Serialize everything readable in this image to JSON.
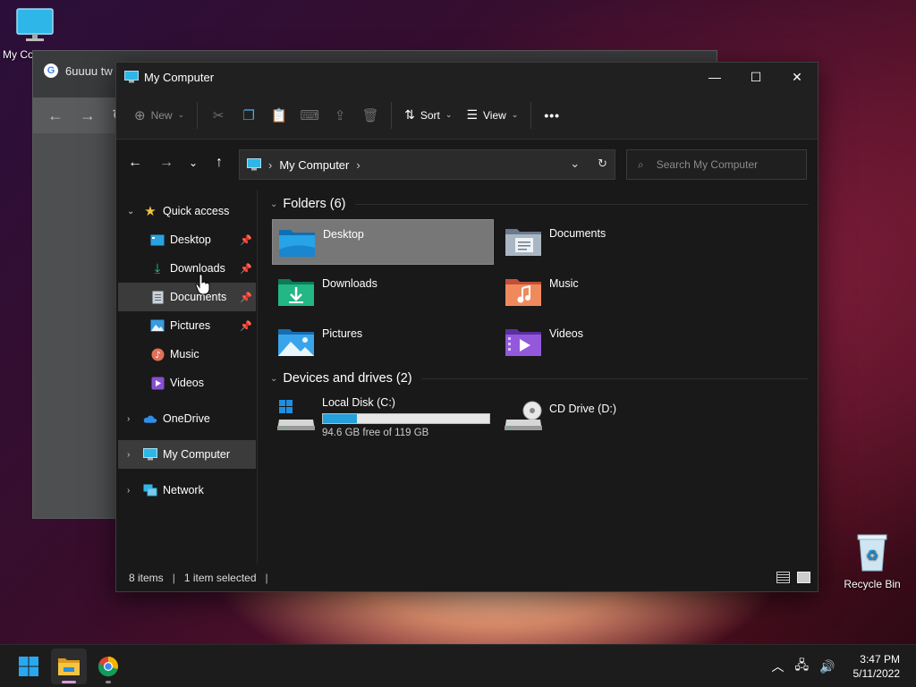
{
  "desktop": {
    "icons": [
      {
        "label": "My Computer",
        "icon": "monitor-icon"
      },
      {
        "label": "Recycle Bin",
        "icon": "recycle-bin-icon"
      }
    ]
  },
  "background_window": {
    "tab_title": "6uuuu tw"
  },
  "window": {
    "title": "My Computer",
    "controls": {
      "minimize": "—",
      "maximize": "☐",
      "close": "✕"
    }
  },
  "toolbar": {
    "new_label": "New",
    "sort_label": "Sort",
    "view_label": "View",
    "more_label": "•••",
    "disabled_actions": [
      "cut-icon",
      "copy-icon",
      "paste-icon",
      "rename-icon",
      "share-icon",
      "delete-icon"
    ]
  },
  "address": {
    "crumb": "My Computer",
    "search_placeholder": "Search My Computer"
  },
  "sidebar": {
    "quick_access": "Quick access",
    "items": [
      {
        "label": "Desktop",
        "pinned": true
      },
      {
        "label": "Downloads",
        "pinned": true
      },
      {
        "label": "Documents",
        "pinned": true
      },
      {
        "label": "Pictures",
        "pinned": true
      },
      {
        "label": "Music",
        "pinned": false
      },
      {
        "label": "Videos",
        "pinned": false
      }
    ],
    "onedrive": "OneDrive",
    "my_computer": "My Computer",
    "network": "Network"
  },
  "main": {
    "folders_header": "Folders (6)",
    "folders": [
      {
        "label": "Desktop",
        "color": "#1e90d6",
        "selected": true
      },
      {
        "label": "Documents",
        "color": "#9aa7b5",
        "selected": false
      },
      {
        "label": "Downloads",
        "color": "#1aa87c",
        "selected": false
      },
      {
        "label": "Music",
        "color": "#e5734f",
        "selected": false
      },
      {
        "label": "Pictures",
        "color": "#2b8fdc",
        "selected": false
      },
      {
        "label": "Videos",
        "color": "#8a4fd0",
        "selected": false
      }
    ],
    "drives_header": "Devices and drives (2)",
    "drives": [
      {
        "label": "Local Disk (C:)",
        "free_text": "94.6 GB free of 119 GB",
        "used_fraction": 0.205
      },
      {
        "label": "CD Drive (D:)"
      }
    ]
  },
  "status": {
    "items": "8 items",
    "selected": "1 item selected"
  },
  "taskbar": {
    "time": "3:47 PM",
    "date": "5/11/2022"
  },
  "colors": {
    "accent": "#26a0da",
    "window_bg": "#191919",
    "selection": "#777777"
  }
}
